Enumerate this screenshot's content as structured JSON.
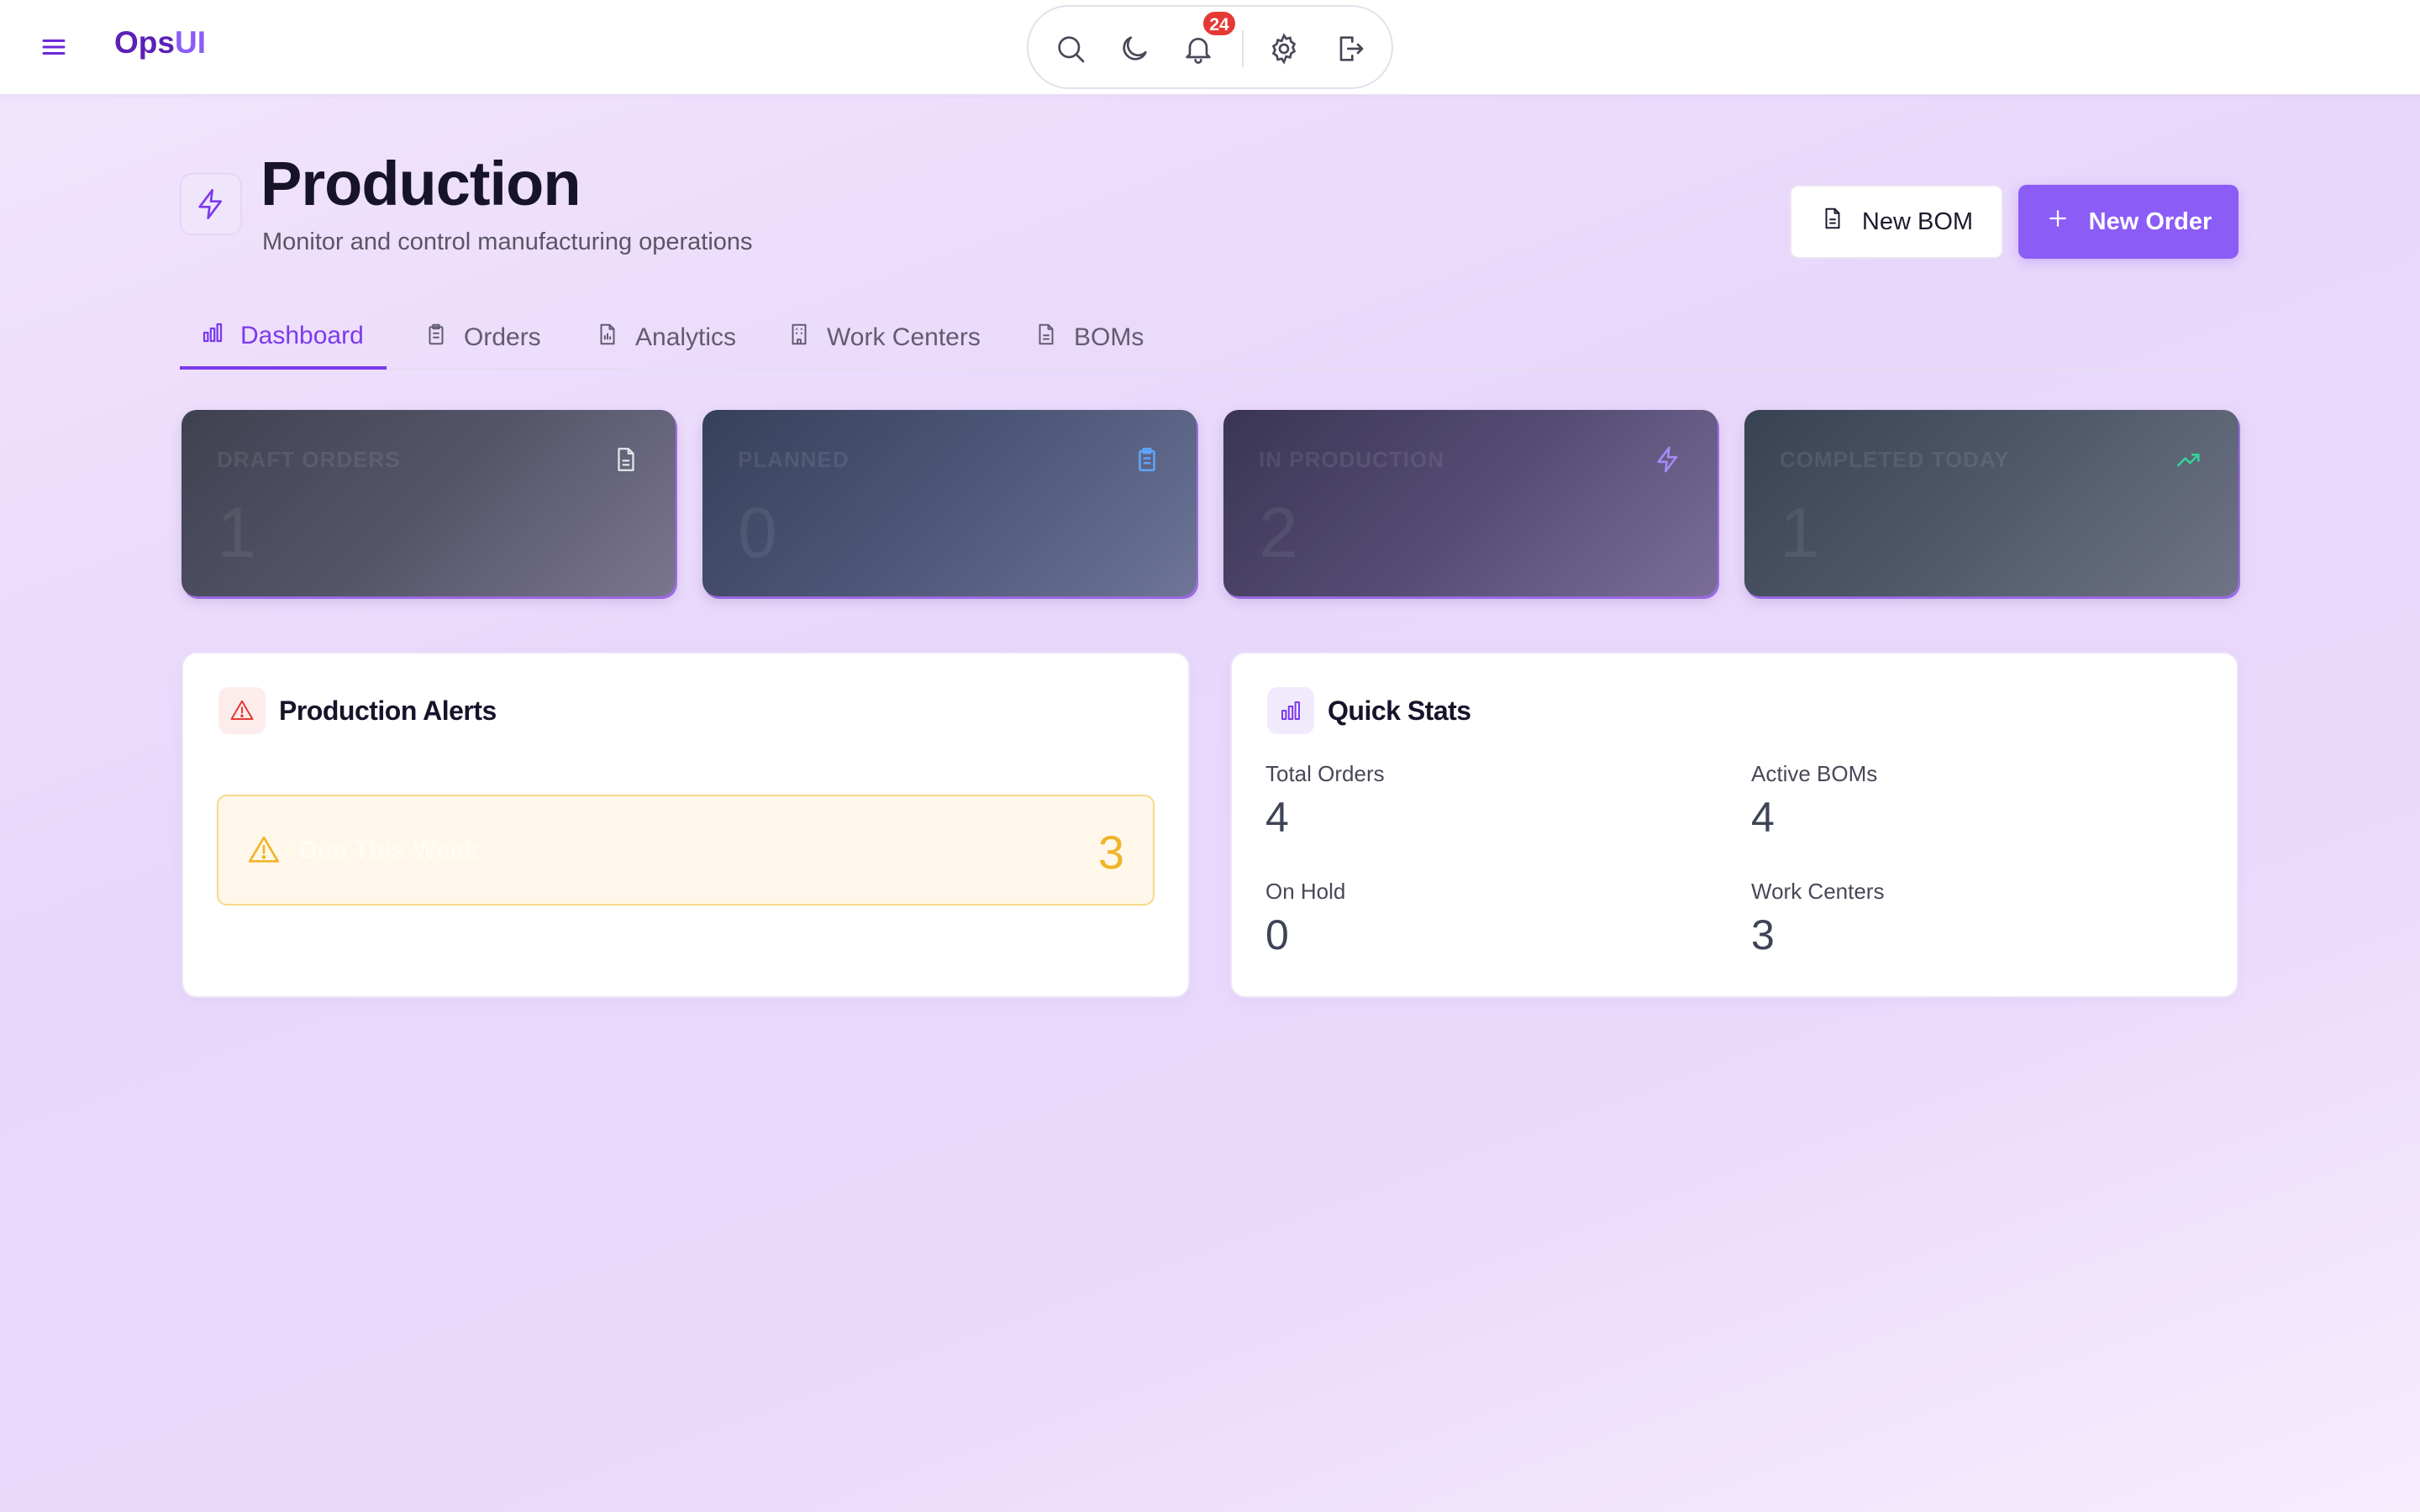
{
  "app": {
    "brand_prefix": "Ops",
    "brand_suffix": "UI"
  },
  "topbar": {
    "notification_count": "24",
    "icons": [
      "menu-icon",
      "search-icon",
      "moon-icon",
      "bell-icon",
      "gear-icon",
      "logout-icon"
    ]
  },
  "header": {
    "title": "Production",
    "subtitle": "Monitor and control manufacturing operations",
    "new_bom_label": "New BOM",
    "new_order_label": "New Order"
  },
  "tabs": [
    {
      "label": "Dashboard",
      "active": true
    },
    {
      "label": "Orders",
      "active": false
    },
    {
      "label": "Analytics",
      "active": false
    },
    {
      "label": "Work Centers",
      "active": false
    },
    {
      "label": "BOMs",
      "active": false
    }
  ],
  "stat_cards": [
    {
      "label": "DRAFT ORDERS",
      "value": "1",
      "icon": "document-icon",
      "icon_color": "#e5e7eb"
    },
    {
      "label": "PLANNED",
      "value": "0",
      "icon": "clipboard-icon",
      "icon_color": "#60a5fa"
    },
    {
      "label": "IN PRODUCTION",
      "value": "2",
      "icon": "bolt-icon",
      "icon_color": "#a78bfa"
    },
    {
      "label": "COMPLETED TODAY",
      "value": "1",
      "icon": "trend-up-icon",
      "icon_color": "#34d399"
    }
  ],
  "alerts": {
    "title": "Production Alerts",
    "items": [
      {
        "label": "Due This Week",
        "count": "3"
      }
    ]
  },
  "quick_stats": {
    "title": "Quick Stats",
    "items": [
      {
        "label": "Total Orders",
        "value": "4"
      },
      {
        "label": "Active BOMs",
        "value": "4"
      },
      {
        "label": "On Hold",
        "value": "0"
      },
      {
        "label": "Work Centers",
        "value": "3"
      }
    ]
  },
  "colors": {
    "accent": "#8b5cf6",
    "accent_dark": "#7c3aed",
    "alert_red": "#e53935",
    "warning": "#f0b429"
  }
}
